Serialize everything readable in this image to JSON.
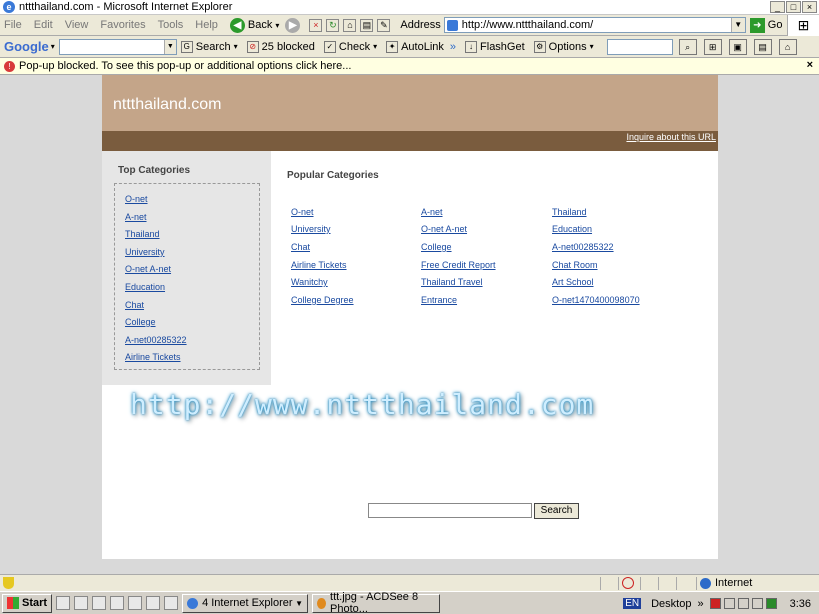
{
  "window": {
    "title": "nttthailand.com - Microsoft Internet Explorer",
    "controls": [
      "_",
      "□",
      "×"
    ]
  },
  "menu": [
    "File",
    "Edit",
    "View",
    "Favorites",
    "Tools",
    "Help"
  ],
  "nav": {
    "back_label": "Back",
    "address_label": "Address",
    "address_value": "http://www.nttthailand.com/",
    "go_label": "Go"
  },
  "google_toolbar": {
    "logo": "Google",
    "search_label": "Search",
    "blocked_label": "25 blocked",
    "check_label": "Check",
    "autolink_label": "AutoLink",
    "more_label": "»",
    "flashget_label": "FlashGet",
    "options_label": "Options"
  },
  "popup_bar": {
    "message": "Pop-up blocked. To see this pop-up or additional options click here...",
    "close": "×"
  },
  "site": {
    "title": "nttthailand.com",
    "inquire": "Inquire about this URL",
    "top_categories_heading": "Top Categories",
    "top_categories": [
      "O-net",
      "A-net",
      "Thailand",
      "University",
      "O-net A-net",
      "Education",
      "Chat",
      "College",
      "A-net00285322",
      "Airline Tickets"
    ],
    "popular_heading": "Popular Categories",
    "popular": [
      [
        "O-net",
        "A-net",
        "Thailand"
      ],
      [
        "University",
        "O-net A-net",
        "Education"
      ],
      [
        "Chat",
        "College",
        "A-net00285322"
      ],
      [
        "Airline Tickets",
        "Free Credit Report",
        "Chat Room"
      ],
      [
        "Wanitchy",
        "Thailand Travel",
        "Art School"
      ],
      [
        "College Degree",
        "Entrance",
        "O-net1470400098070"
      ]
    ],
    "banner": "http://www.nttthailand.com",
    "search_button": "Search"
  },
  "statusbar": {
    "zone": "Internet"
  },
  "taskbar": {
    "start": "Start",
    "task1": "4 Internet Explorer",
    "task2": "ttt.jpg - ACDSee 8 Photo...",
    "lang": "EN",
    "desktop": "Desktop",
    "more": "»",
    "clock": "3:36"
  }
}
